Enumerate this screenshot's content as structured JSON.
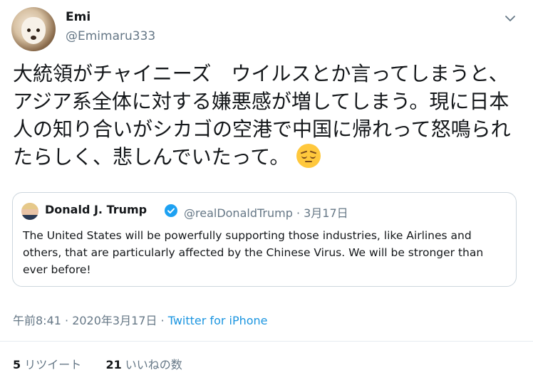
{
  "tweet": {
    "author_name": "Emi",
    "author_handle": "@Emimaru333",
    "text": "大統領がチャイニーズ　ウイルスとか言ってしまうと、アジア系全体に対する嫌悪感が増してしまう。現に日本人の知り合いがシカゴの空港で中国に帰れって怒鳴られたらしく、悲しんでいたって。",
    "emoji": "pensive-face-emoji"
  },
  "quoted": {
    "name": "Donald J. Trump",
    "meta": "@realDonaldTrump · 3月17日",
    "text": "The United States will be powerfully supporting those industries, like Airlines and others, that are particularly affected by the Chinese Virus. We will be stronger than ever before!"
  },
  "footer": {
    "time": "午前8:41 · 2020年3月17日 · ",
    "source": "Twitter for iPhone",
    "retweets_count": "5",
    "retweets_label": "リツイート",
    "likes_count": "21",
    "likes_label": "いいねの数"
  },
  "colors": {
    "link": "#1b95e0",
    "muted": "#657786",
    "text": "#14171a"
  }
}
